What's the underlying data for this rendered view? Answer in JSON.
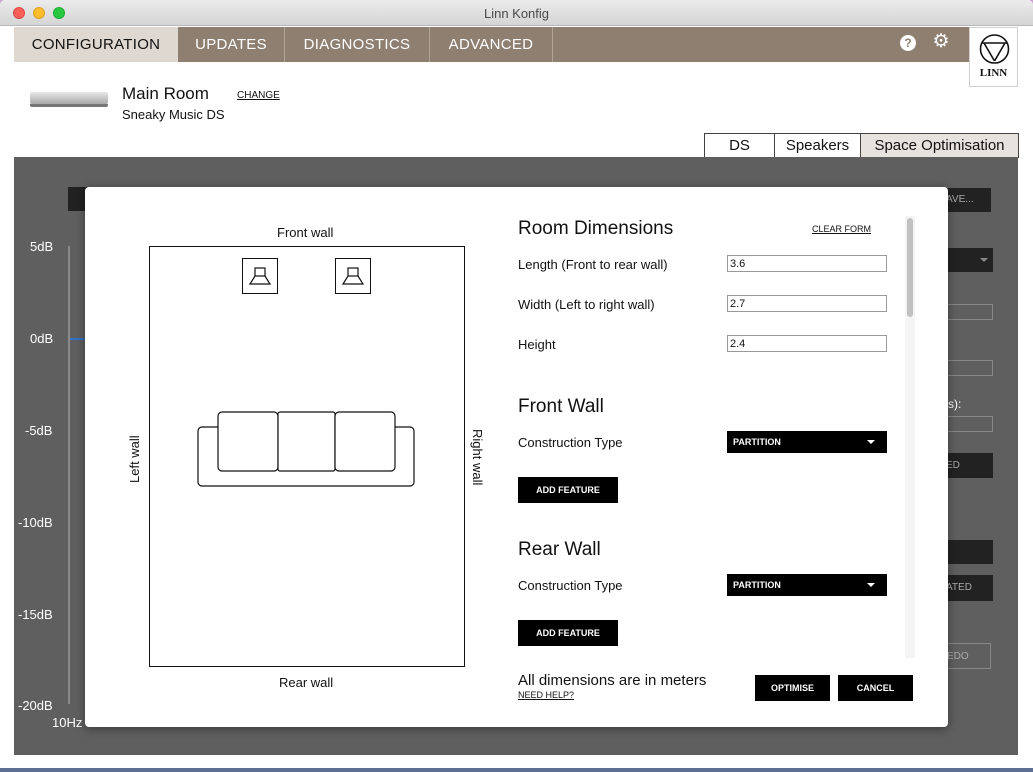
{
  "window": {
    "title": "Linn Konfig"
  },
  "tabs": [
    "CONFIGURATION",
    "UPDATES",
    "DIAGNOSTICS",
    "ADVANCED"
  ],
  "header": {
    "help_icon": "?",
    "gear_icon": "⚙",
    "logo_text": "LINN"
  },
  "device": {
    "room": "Main Room",
    "name": "Sneaky Music DS",
    "change": "CHANGE"
  },
  "subtabs": [
    "DS",
    "Speakers",
    "Space Optimisation"
  ],
  "background": {
    "db_labels": [
      "5dB",
      "0dB",
      "-5dB",
      "-10dB",
      "-15dB",
      "-20dB"
    ],
    "hz_label": "10Hz",
    "partial": {
      "save": "AVE...",
      "s": "s):",
      "ed": "ED",
      "ated": "ATED",
      "edo": "EDO"
    }
  },
  "diagram": {
    "front_wall": "Front wall",
    "rear_wall": "Rear wall",
    "left_wall": "Left wall",
    "right_wall": "Right wall"
  },
  "form": {
    "room_dimensions": "Room Dimensions",
    "clear_form": "CLEAR FORM",
    "length_label": "Length (Front to rear wall)",
    "length_value": "3.6",
    "width_label": "Width (Left to right wall)",
    "width_value": "2.7",
    "height_label": "Height",
    "height_value": "2.4",
    "front_wall": "Front Wall",
    "front_construction_label": "Construction Type",
    "front_construction_value": "PARTITION",
    "add_feature": "ADD FEATURE",
    "rear_wall": "Rear Wall",
    "rear_construction_label": "Construction Type",
    "rear_construction_value": "PARTITION"
  },
  "footer": {
    "note": "All dimensions are in meters",
    "help": "NEED HELP?",
    "optimise": "OPTIMISE",
    "cancel": "CANCEL"
  }
}
